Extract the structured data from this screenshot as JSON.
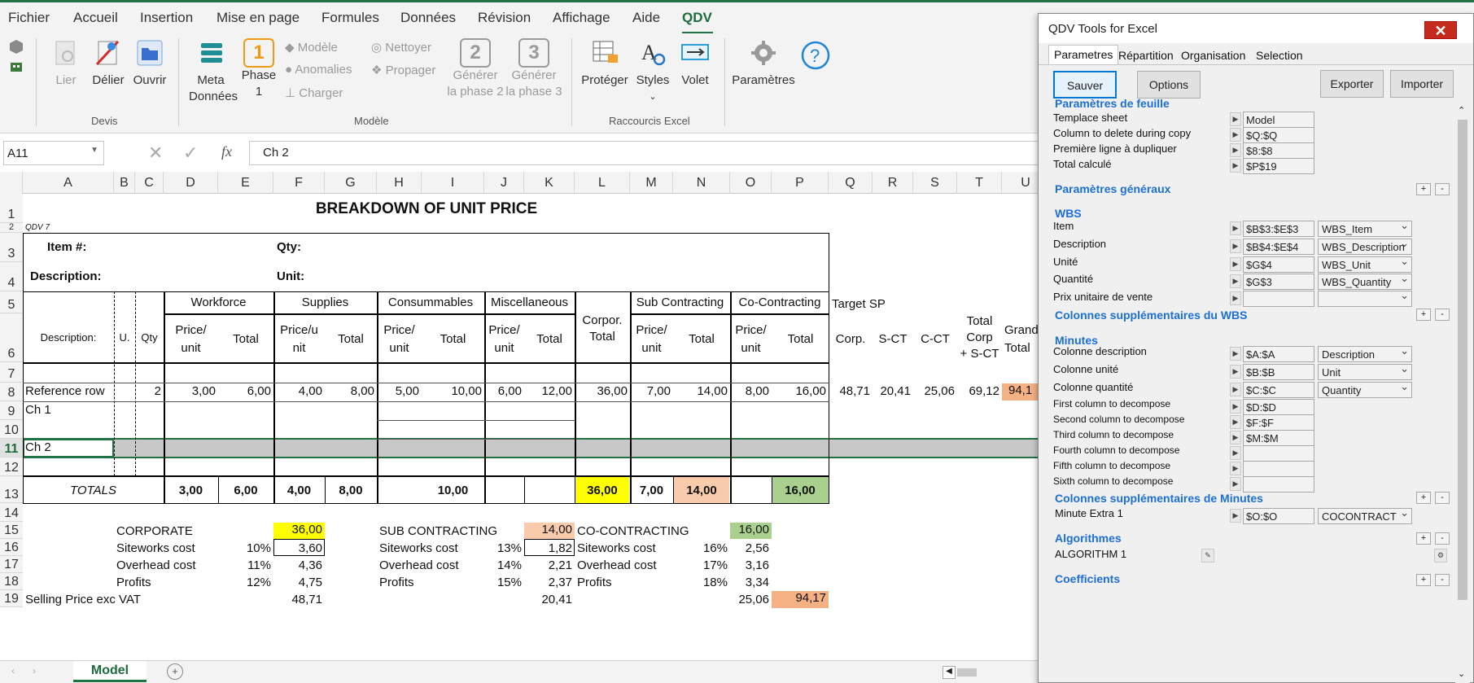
{
  "menu": {
    "tabs": [
      "Fichier",
      "Accueil",
      "Insertion",
      "Mise en page",
      "Formules",
      "Données",
      "Révision",
      "Affichage",
      "Aide",
      "QDV"
    ]
  },
  "ribbon": {
    "devis": {
      "lier": "Lier",
      "delier": "Délier",
      "ouvrir": "Ouvrir",
      "group": "Devis"
    },
    "modele": {
      "meta1": "Meta",
      "meta2": "Données",
      "phase1a": "Phase",
      "phase1b": "1",
      "modele": "Modèle",
      "anomalies": "Anomalies",
      "charger": "Charger",
      "nettoyer": "Nettoyer",
      "propager": "Propager",
      "gen2a": "Générer",
      "gen2b": "la phase 2",
      "gen3a": "Générer",
      "gen3b": "la phase 3",
      "num1": "1",
      "num2": "2",
      "num3": "3",
      "group": "Modèle"
    },
    "raccourcis": {
      "proteger": "Protéger",
      "styles": "Styles",
      "volet": "Volet",
      "group": "Raccourcis Excel"
    },
    "parametres": "Paramètres"
  },
  "formula_bar": {
    "name_box": "A11",
    "fx": "fx",
    "formula": "Ch 2"
  },
  "columns": [
    "A",
    "B",
    "C",
    "D",
    "E",
    "F",
    "G",
    "H",
    "I",
    "J",
    "K",
    "L",
    "M",
    "N",
    "O",
    "P",
    "Q",
    "R",
    "S",
    "T",
    "U"
  ],
  "rows": [
    "1",
    "2",
    "3",
    "4",
    "5",
    "6",
    "7",
    "8",
    "9",
    "10",
    "11",
    "12",
    "13",
    "14",
    "15",
    "16",
    "17",
    "18",
    "19"
  ],
  "sheet": {
    "title": "BREAKDOWN OF UNIT PRICE",
    "qdv": "QDV 7",
    "item": "Item #:",
    "qty": "Qty:",
    "description": "Description:",
    "unit": "Unit:",
    "h_workforce": "Workforce",
    "h_supplies": "Supplies",
    "h_consumables": "Consummables",
    "h_misc": "Miscellaneous",
    "h_corpor1": "Corpor.",
    "h_corpor2": "Total",
    "h_sub": "Sub Contracting",
    "h_co": "Co-Contracting",
    "h_target": "Target SP",
    "h_desc": "Description:",
    "h_u": "U.",
    "h_qty": "Qty",
    "h_price1": "Price/",
    "h_price2": "unit",
    "h_total": "Total",
    "h_priceu1": "Price/u",
    "h_priceu2": "nit",
    "h_corp": "Corp.",
    "h_sct": "S-CT",
    "h_cct": "C-CT",
    "h_tc1": "Total",
    "h_tc2": "Corp",
    "h_tc3": "+ S-CT",
    "h_grand1": "Grand",
    "h_grand2": "Total",
    "ref": {
      "label": "Reference row",
      "qty": "2",
      "d": "3,00",
      "e": "6,00",
      "f": "4,00",
      "g": "8,00",
      "h": "5,00",
      "i": "10,00",
      "j": "6,00",
      "k": "12,00",
      "l": "36,00",
      "m": "7,00",
      "n": "14,00",
      "o": "8,00",
      "p": "16,00",
      "q": "48,71",
      "r": "20,41",
      "s": "25,06",
      "t": "69,12",
      "u": "94,1"
    },
    "ch1": "Ch 1",
    "ch2": "Ch 2",
    "totals": {
      "label": "TOTALS",
      "d": "3,00",
      "e": "6,00",
      "f": "4,00",
      "g": "8,00",
      "i": "10,00",
      "l": "36,00",
      "m": "7,00",
      "n": "14,00",
      "p": "16,00"
    },
    "corporate": "CORPORATE",
    "corp_val": "36,00",
    "subc": "SUB CONTRACTING",
    "subc_val": "14,00",
    "coc": "CO-CONTRACTING",
    "coc_val": "16,00",
    "siteworks": "Siteworks cost",
    "overhead": "Overhead cost",
    "profits": "Profits",
    "s1p": "10%",
    "s1v": "3,60",
    "s2p": "11%",
    "s2v": "4,36",
    "s3p": "12%",
    "s3v": "4,75",
    "t1p": "13%",
    "t1v": "1,82",
    "t2p": "14%",
    "t2v": "2,21",
    "t3p": "15%",
    "t3v": "2,37",
    "u1p": "16%",
    "u1v": "2,56",
    "u2p": "17%",
    "u2v": "3,16",
    "u3p": "18%",
    "u3v": "3,34",
    "selling": "Selling Price  exc VAT",
    "sell_f": "48,71",
    "sell_k": "20,41",
    "sell_o": "25,06",
    "sell_p": "94,17"
  },
  "sheet_tab": "Model",
  "colors": {
    "excel_green": "#217346",
    "yellow": "#ffff00",
    "peach": "#f8cbad",
    "green": "#a9d08e",
    "orange": "#f4b183",
    "selrow": "#c8c8c8"
  },
  "panel": {
    "title": "QDV Tools for Excel",
    "tabs": [
      "Parametres",
      "Répartition",
      "Organisation",
      "Selection"
    ],
    "sauver": "Sauver",
    "options": "Options",
    "exporter": "Exporter",
    "importer": "Importer",
    "sec_feuille": "Paramètres de feuille",
    "template": "Templace sheet",
    "template_v": "Model",
    "coldel": "Column to delete during copy",
    "coldel_v": "$Q:$Q",
    "premiere": "Première ligne à dupliquer",
    "premiere_v": "$8:$8",
    "totalc": "Total calculé",
    "totalc_v": "$P$19",
    "sec_gen": "Paramètres généraux",
    "sec_wbs": "WBS",
    "item": "Item",
    "item_v": "$B$3:$E$3",
    "item_d": "WBS_Item",
    "desc": "Description",
    "desc_v": "$B$4:$E$4",
    "desc_d": "WBS_Description",
    "unite": "Unité",
    "unite_v": "$G$4",
    "unite_d": "WBS_Unit",
    "quant": "Quantité",
    "quant_v": "$G$3",
    "quant_d": "WBS_Quantity",
    "prix": "Prix unitaire de vente",
    "sec_wbs_sup": "Colonnes supplémentaires du WBS",
    "sec_min": "Minutes",
    "cdesc": "Colonne description",
    "cdesc_v": "$A:$A",
    "cdesc_d": "Description",
    "cunit": "Colonne unité",
    "cunit_v": "$B:$B",
    "cunit_d": "Unit",
    "cqty": "Colonne quantité",
    "cqty_v": "$C:$C",
    "cqty_d": "Quantity",
    "first": "First column to decompose",
    "first_v": "$D:$D",
    "second": "Second column to decompose",
    "second_v": "$F:$F",
    "third": "Third column to decompose",
    "third_v": "$M:$M",
    "fourth": "Fourth column to decompose",
    "fifth": "Fifth column to decompose",
    "sixth": "Sixth column to decompose",
    "sec_min_sup": "Colonnes supplémentaires de Minutes",
    "extra1": "Minute Extra 1",
    "extra1_v": "$O:$O",
    "extra1_d": "COCONTRACT",
    "sec_algo": "Algorithmes",
    "algo1": "ALGORITHM 1",
    "sec_coef": "Coefficients",
    "plus": "+",
    "minus": "-"
  }
}
